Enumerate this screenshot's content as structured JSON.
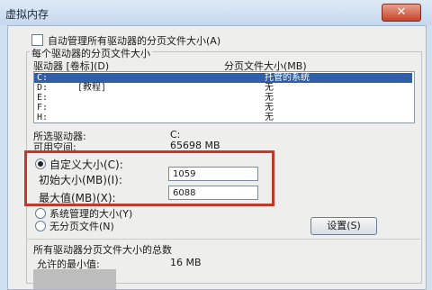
{
  "window": {
    "title": "虚拟内存",
    "close_glyph": "✕"
  },
  "auto_manage": {
    "label": "自动管理所有驱动器的分页文件大小(A)",
    "checked": false
  },
  "per_drive": {
    "heading": "每个驱动器的分页文件大小",
    "col_drive": "驱动器 [卷标](D)",
    "col_size": "分页文件大小(MB)",
    "rows": [
      {
        "drive": "C:",
        "label": "",
        "size": "托管的系统",
        "selected": true
      },
      {
        "drive": "D:",
        "label": "[教程]",
        "size": "无",
        "selected": false
      },
      {
        "drive": "E:",
        "label": "",
        "size": "无",
        "selected": false
      },
      {
        "drive": "F:",
        "label": "",
        "size": "无",
        "selected": false
      },
      {
        "drive": "H:",
        "label": "",
        "size": "无",
        "selected": false
      }
    ]
  },
  "selected_drive": {
    "label": "所选驱动器:",
    "value": "C:"
  },
  "free_space": {
    "label": "可用空间:",
    "value": "65698 MB"
  },
  "custom_size": {
    "label": "自定义大小(C):",
    "initial_label": "初始大小(MB)(I):",
    "initial_value": "1059",
    "max_label": "最大值(MB)(X):",
    "max_value": "6088"
  },
  "system_managed": {
    "label": "系统管理的大小(Y)"
  },
  "no_paging": {
    "label": "无分页文件(N)"
  },
  "set_button": "设置(S)",
  "totals": {
    "heading": "所有驱动器分页文件大小的总数",
    "min_label": "允许的最小值:",
    "min_value": "16 MB"
  }
}
